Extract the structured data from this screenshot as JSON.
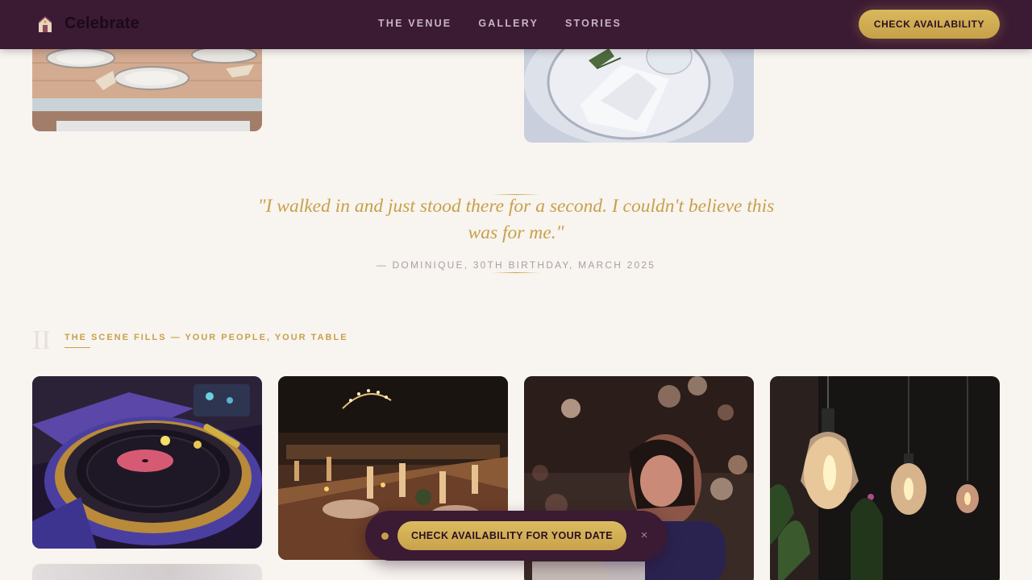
{
  "header": {
    "brand_name": "Celebrate",
    "nav": [
      "THE VENUE",
      "GALLERY",
      "STORIES"
    ],
    "cta_label": "CHECK AVAILABILITY"
  },
  "testimonial": {
    "quote": "\"I walked in and just stood there for a second. I couldn't believe this was for me.\"",
    "attribution": "— DOMINIQUE, 30TH BIRTHDAY, MARCH 2025"
  },
  "section": {
    "number": "II",
    "title": "THE SCENE FILLS — YOUR PEOPLE, YOUR TABLE"
  },
  "floating_bar": {
    "cta_label": "CHECK AVAILABILITY FOR YOUR DATE",
    "close_symbol": "×"
  },
  "colors": {
    "nav_bg": "#3b1a33",
    "accent_gold": "#c7a14a",
    "page_bg": "#f8f4f0"
  }
}
